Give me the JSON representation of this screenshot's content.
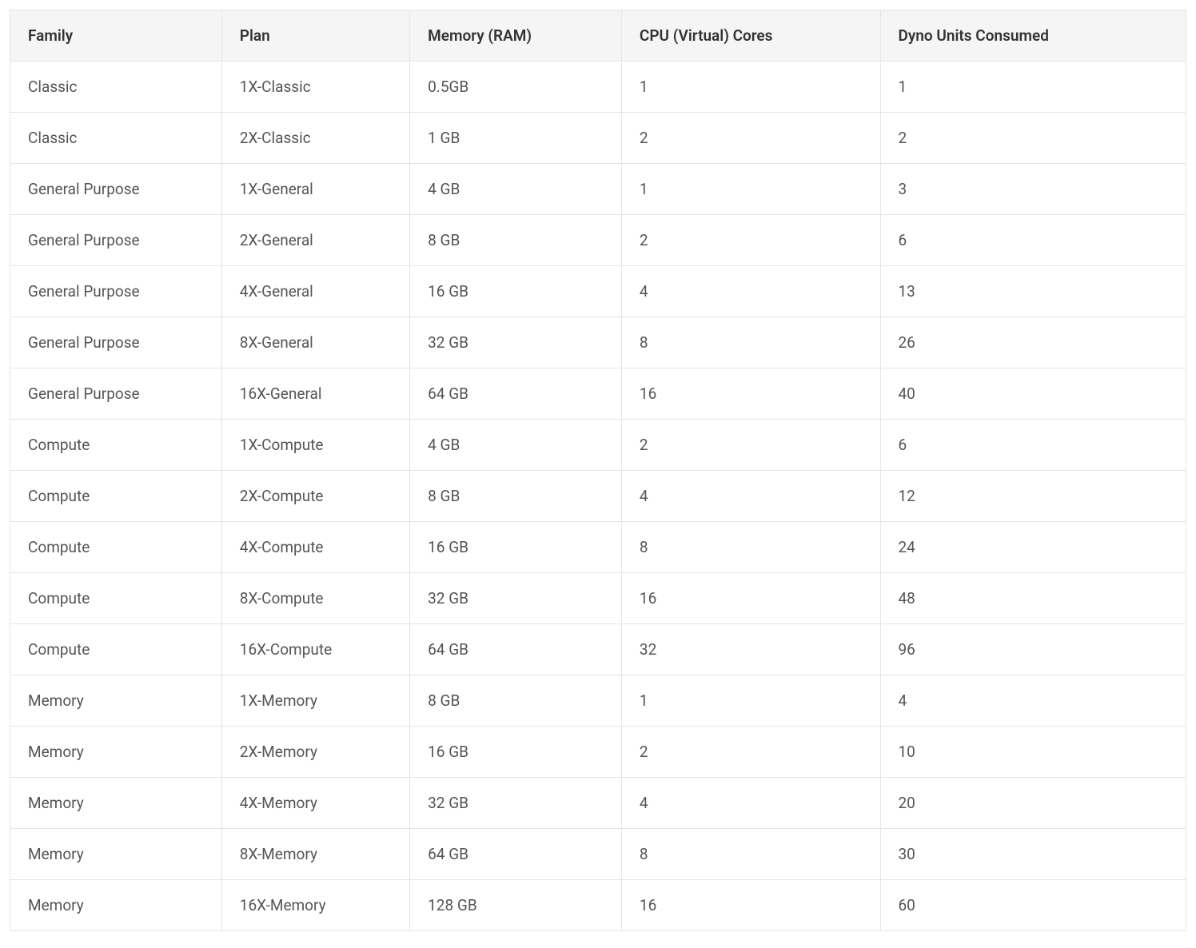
{
  "table": {
    "headers": [
      "Family",
      "Plan",
      "Memory (RAM)",
      "CPU (Virtual) Cores",
      "Dyno Units Consumed"
    ],
    "rows": [
      {
        "family": "Classic",
        "plan": "1X-Classic",
        "memory": "0.5GB",
        "cpu": "1",
        "dyno": "1"
      },
      {
        "family": "Classic",
        "plan": "2X-Classic",
        "memory": "1 GB",
        "cpu": "2",
        "dyno": "2"
      },
      {
        "family": "General Purpose",
        "plan": "1X-General",
        "memory": "4 GB",
        "cpu": "1",
        "dyno": "3"
      },
      {
        "family": "General Purpose",
        "plan": "2X-General",
        "memory": "8 GB",
        "cpu": "2",
        "dyno": "6"
      },
      {
        "family": "General Purpose",
        "plan": "4X-General",
        "memory": "16 GB",
        "cpu": "4",
        "dyno": "13"
      },
      {
        "family": "General Purpose",
        "plan": "8X-General",
        "memory": "32 GB",
        "cpu": "8",
        "dyno": "26"
      },
      {
        "family": "General Purpose",
        "plan": "16X-General",
        "memory": "64 GB",
        "cpu": "16",
        "dyno": "40"
      },
      {
        "family": "Compute",
        "plan": "1X-Compute",
        "memory": "4 GB",
        "cpu": "2",
        "dyno": "6"
      },
      {
        "family": "Compute",
        "plan": "2X-Compute",
        "memory": "8 GB",
        "cpu": "4",
        "dyno": "12"
      },
      {
        "family": "Compute",
        "plan": "4X-Compute",
        "memory": "16 GB",
        "cpu": "8",
        "dyno": "24"
      },
      {
        "family": "Compute",
        "plan": "8X-Compute",
        "memory": "32 GB",
        "cpu": "16",
        "dyno": "48"
      },
      {
        "family": "Compute",
        "plan": "16X-Compute",
        "memory": "64 GB",
        "cpu": "32",
        "dyno": "96"
      },
      {
        "family": "Memory",
        "plan": "1X-Memory",
        "memory": "8 GB",
        "cpu": "1",
        "dyno": "4"
      },
      {
        "family": "Memory",
        "plan": "2X-Memory",
        "memory": "16 GB",
        "cpu": "2",
        "dyno": "10"
      },
      {
        "family": "Memory",
        "plan": "4X-Memory",
        "memory": "32 GB",
        "cpu": "4",
        "dyno": "20"
      },
      {
        "family": "Memory",
        "plan": "8X-Memory",
        "memory": "64 GB",
        "cpu": "8",
        "dyno": "30"
      },
      {
        "family": "Memory",
        "plan": "16X-Memory",
        "memory": "128 GB",
        "cpu": "16",
        "dyno": "60"
      }
    ]
  }
}
